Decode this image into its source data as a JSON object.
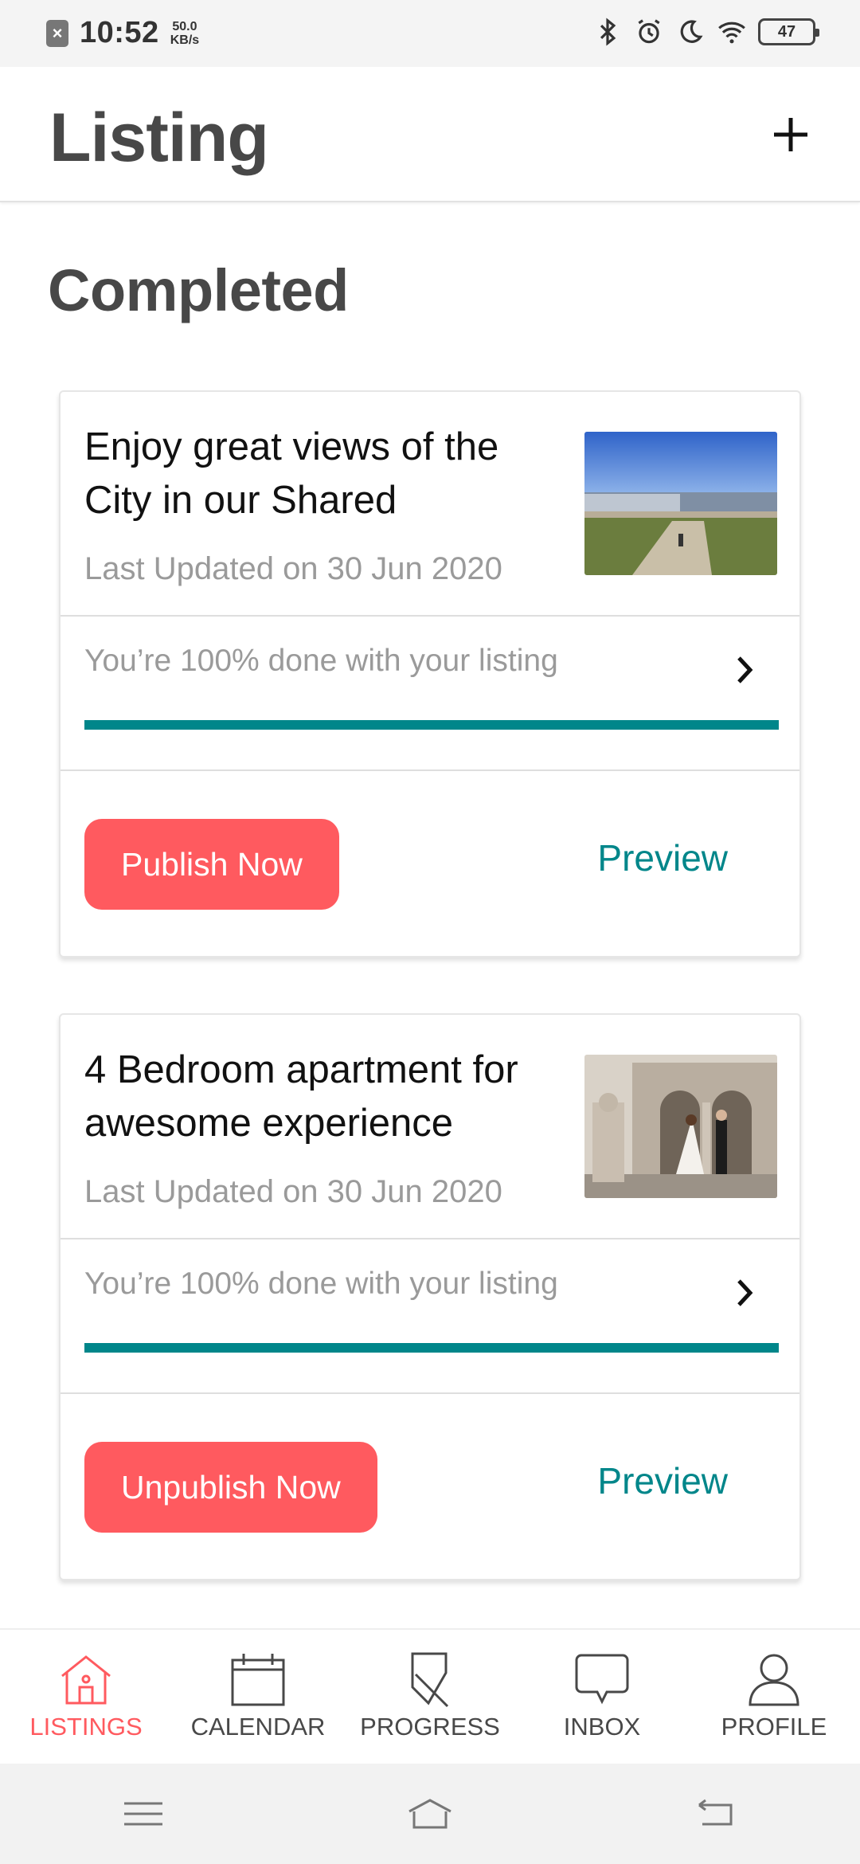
{
  "status_bar": {
    "time": "10:52",
    "speed_value": "50.0",
    "speed_unit": "KB/s",
    "battery": "47"
  },
  "header": {
    "title": "Listing",
    "add_icon": "plus-icon"
  },
  "section_title": "Completed",
  "listings": [
    {
      "title": "Enjoy great views of the City in our Shared",
      "updated": "Last Updated on 30 Jun 2020",
      "progress_text": "You’re 100% done with your listing",
      "progress": 1.0,
      "primary_action": "Publish Now",
      "secondary_action": "Preview",
      "image": "lake-promenade-photo"
    },
    {
      "title": "4 Bedroom apartment for awesome experience",
      "updated": "Last Updated on 30 Jun 2020",
      "progress_text": "You’re 100% done with your listing",
      "progress": 1.0,
      "primary_action": "Unpublish Now",
      "secondary_action": "Preview",
      "image": "wedding-couple-castle-photo"
    }
  ],
  "bottom_nav": [
    {
      "label": "LISTINGS",
      "icon": "home-icon",
      "active": true
    },
    {
      "label": "CALENDAR",
      "icon": "calendar-icon",
      "active": false
    },
    {
      "label": "PROGRESS",
      "icon": "progress-icon",
      "active": false
    },
    {
      "label": "INBOX",
      "icon": "chat-bubble-icon",
      "active": false
    },
    {
      "label": "PROFILE",
      "icon": "person-icon",
      "active": false
    }
  ],
  "colors": {
    "accent": "#ff5a5f",
    "teal": "#00868a",
    "text_dark": "#484848",
    "text_muted": "#9a9a9a"
  }
}
